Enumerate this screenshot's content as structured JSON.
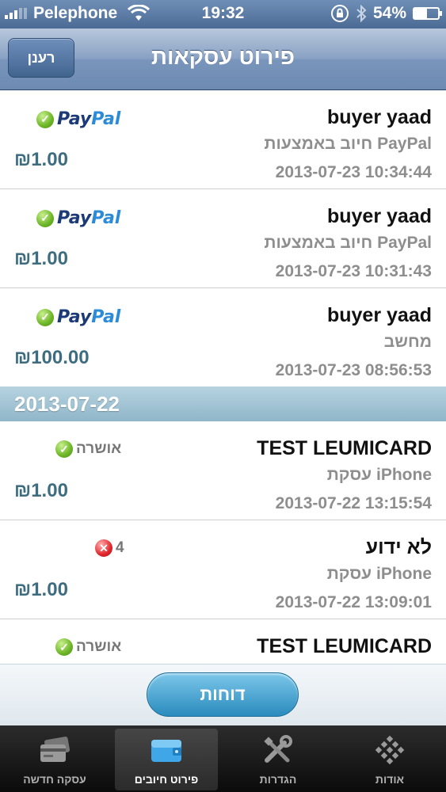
{
  "status_bar": {
    "carrier": "Pelephone",
    "time": "19:32",
    "battery": "54%",
    "battery_level": 0.54
  },
  "nav": {
    "refresh_label": "רענן",
    "title": "פירוט עסקאות"
  },
  "transactions_today": [
    {
      "name": "buyer yaad",
      "desc": "חיוב באמצעות PayPal",
      "datetime": "2013-07-23 10:34:44",
      "amount": "₪1.00",
      "method": "PayPal"
    },
    {
      "name": "buyer yaad",
      "desc": "חיוב באמצעות PayPal",
      "datetime": "2013-07-23 10:31:43",
      "amount": "₪1.00",
      "method": "PayPal"
    },
    {
      "name": "buyer yaad",
      "desc": "מחשב",
      "datetime": "2013-07-23 08:56:53",
      "amount": "₪100.00",
      "method": "PayPal"
    }
  ],
  "section_header": "2013-07-22",
  "transactions_prev": [
    {
      "name": "TEST LEUMICARD",
      "desc": "עסקת iPhone",
      "datetime": "2013-07-22 13:15:54",
      "amount": "₪1.00",
      "status": "אושרה",
      "status_type": "ok"
    },
    {
      "name": "לא ידוע",
      "desc": "עסקת iPhone",
      "datetime": "2013-07-22 13:09:01",
      "amount": "₪1.00",
      "status": "4",
      "status_type": "error"
    },
    {
      "name": "TEST LEUMICARD",
      "desc": "",
      "datetime": "",
      "amount": "",
      "status": "אושרה",
      "status_type": "ok"
    }
  ],
  "paypal_logo": {
    "part1": "Pay",
    "part2": "Pal"
  },
  "reports_label": "דוחות",
  "tabs": [
    {
      "label": "עסקה חדשה",
      "icon": "credit-card-icon"
    },
    {
      "label": "פירוט חיובים",
      "icon": "wallet-icon"
    },
    {
      "label": "הגדרות",
      "icon": "tools-icon"
    },
    {
      "label": "אודות",
      "icon": "about-icon"
    }
  ]
}
